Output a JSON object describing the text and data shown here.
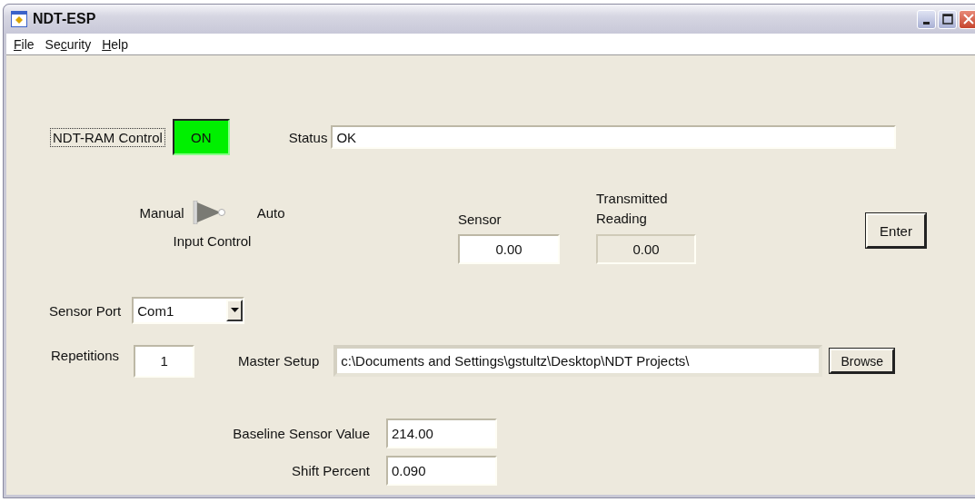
{
  "window": {
    "title": "NDT-ESP"
  },
  "menu": [
    {
      "key": "F",
      "after": "ile"
    },
    {
      "before": "Se",
      "key": "c",
      "after": "urity"
    },
    {
      "key": "H",
      "after": "elp"
    }
  ],
  "ram_control": {
    "label": "NDT-RAM Control",
    "button": "ON",
    "on": true
  },
  "status": {
    "label": "Status",
    "value": "OK"
  },
  "input_control": {
    "label": "Input Control",
    "left_label": "Manual",
    "right_label": "Auto",
    "auto": true
  },
  "sensor": {
    "label": "Sensor",
    "value": "0.00"
  },
  "transmitted_reading": {
    "label": "Transmitted Reading",
    "value": "0.00"
  },
  "enter_button": "Enter",
  "sensor_port": {
    "label": "Sensor Port",
    "value": "Com1"
  },
  "repetitions": {
    "label": "Repetitions",
    "value": "1"
  },
  "master_setup": {
    "label": "Master Setup",
    "value": "c:\\Documents and Settings\\gstultz\\Desktop\\NDT Projects\\",
    "button": "Browse"
  },
  "baseline_sensor_value": {
    "label": "Baseline Sensor Value",
    "value": "214.00"
  },
  "shift_percent": {
    "label": "Shift Percent",
    "value": "0.090"
  }
}
